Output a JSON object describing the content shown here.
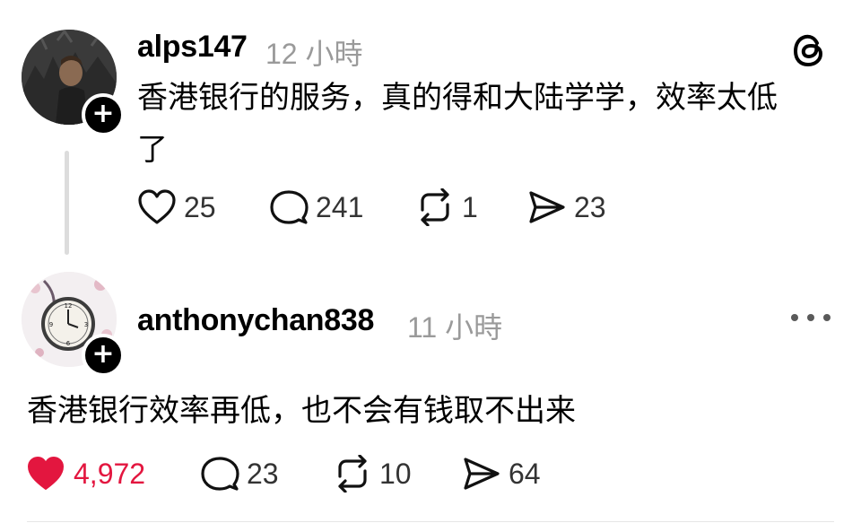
{
  "posts": [
    {
      "username": "alps147",
      "time": "12 小時",
      "text_line1": "香港银行的服务，真的得和大陆学学，效率太低",
      "text_line2": "了",
      "likes": "25",
      "liked": false,
      "replies": "241",
      "reposts": "1",
      "shares": "23"
    },
    {
      "username": "anthonychan838",
      "time": "11 小時",
      "text_line1": "香港银行效率再低，也不会有钱取不出来",
      "likes": "4,972",
      "liked": true,
      "replies": "23",
      "reposts": "10",
      "shares": "64"
    }
  ],
  "icons": {
    "app_logo": "threads-logo-icon",
    "follow": "plus-icon",
    "like": "heart-icon",
    "reply": "comment-bubble-icon",
    "repost": "repost-icon",
    "share": "send-icon",
    "more": "more-options-icon"
  },
  "colors": {
    "liked": "#e3163f",
    "muted": "#9a9a9a",
    "text": "#000000"
  }
}
